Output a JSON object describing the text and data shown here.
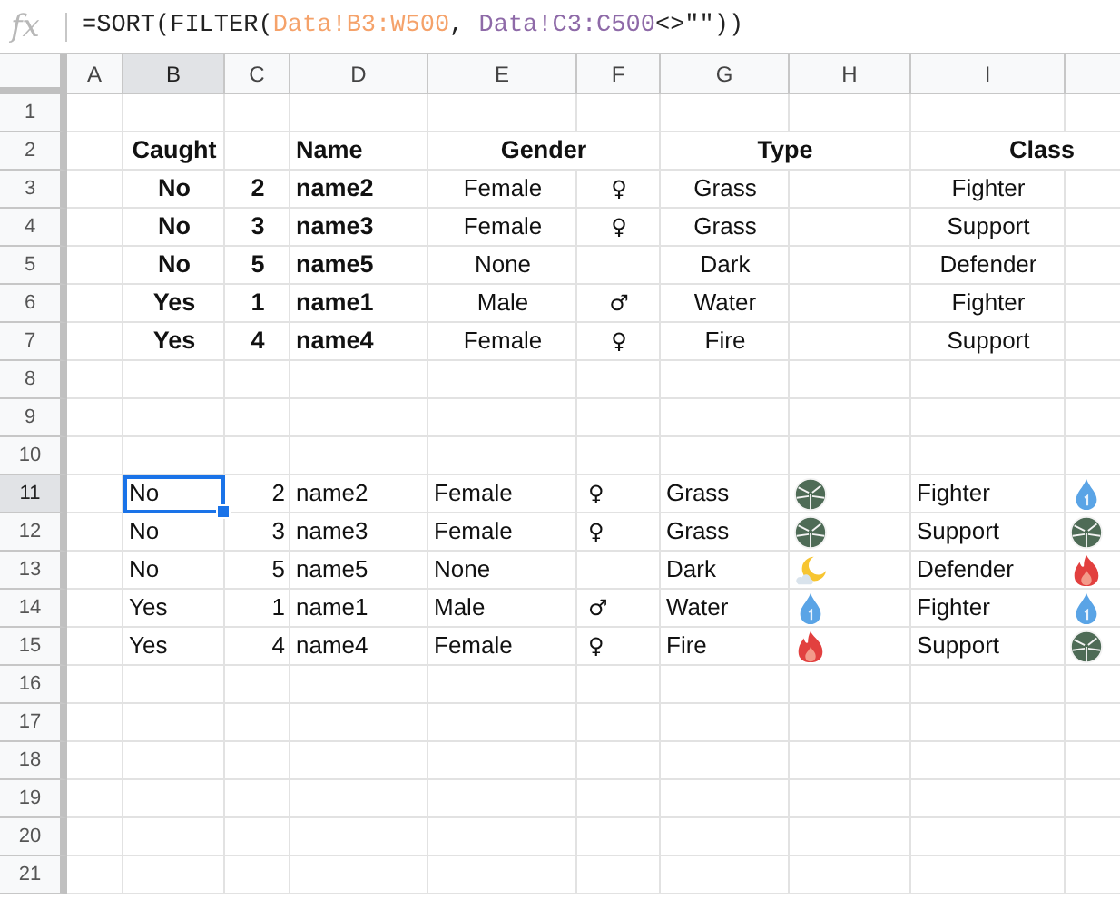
{
  "formula_bar": {
    "fx": "fx",
    "segments": [
      {
        "text": "=SORT(FILTER(",
        "color": "#222222"
      },
      {
        "text": "Data!B3:W500",
        "color": "#f5a26a"
      },
      {
        "text": ", ",
        "color": "#222222"
      },
      {
        "text": "Data!C3:C500",
        "color": "#8e6aa8"
      },
      {
        "text": "<>\"\"))",
        "color": "#222222"
      }
    ]
  },
  "columns": [
    {
      "label": "A",
      "selected": false
    },
    {
      "label": "B",
      "selected": true
    },
    {
      "label": "C",
      "selected": false
    },
    {
      "label": "D",
      "selected": false
    },
    {
      "label": "E",
      "selected": false
    },
    {
      "label": "F",
      "selected": false
    },
    {
      "label": "G",
      "selected": false
    },
    {
      "label": "H",
      "selected": false
    },
    {
      "label": "I",
      "selected": false
    },
    {
      "selected": false
    }
  ],
  "rows": [
    {
      "label": "1",
      "selected": false
    },
    {
      "label": "2",
      "selected": false
    },
    {
      "label": "3",
      "selected": false
    },
    {
      "label": "4",
      "selected": false
    },
    {
      "label": "5",
      "selected": false
    },
    {
      "label": "6",
      "selected": false
    },
    {
      "label": "7",
      "selected": false
    },
    {
      "label": "8",
      "selected": false
    },
    {
      "label": "9",
      "selected": false
    },
    {
      "label": "10",
      "selected": false
    },
    {
      "label": "11",
      "selected": true
    },
    {
      "label": "12",
      "selected": false
    },
    {
      "label": "13",
      "selected": false
    },
    {
      "label": "14",
      "selected": false
    },
    {
      "label": "15",
      "selected": false
    },
    {
      "label": "16",
      "selected": false
    },
    {
      "label": "17",
      "selected": false
    },
    {
      "label": "18",
      "selected": false
    },
    {
      "label": "19",
      "selected": false
    },
    {
      "label": "20",
      "selected": false
    },
    {
      "label": "21",
      "selected": false
    }
  ],
  "header_table": {
    "headers": {
      "caught": "Caught",
      "name": "Name",
      "gender": "Gender",
      "type": "Type",
      "class": "Class"
    },
    "rows": [
      {
        "caught": "No",
        "number": "2",
        "name": "name2",
        "gender": "Female",
        "symbol": "♀",
        "type": "Grass",
        "class": "Fighter"
      },
      {
        "caught": "No",
        "number": "3",
        "name": "name3",
        "gender": "Female",
        "symbol": "♀",
        "type": "Grass",
        "class": "Support"
      },
      {
        "caught": "No",
        "number": "5",
        "name": "name5",
        "gender": "None",
        "type": "Dark",
        "class": "Defender"
      },
      {
        "caught": "Yes",
        "number": "1",
        "name": "name1",
        "gender": "Male",
        "symbol": "♂",
        "type": "Water",
        "class": "Fighter"
      },
      {
        "caught": "Yes",
        "number": "4",
        "name": "name4",
        "gender": "Female",
        "symbol": "♀",
        "type": "Fire",
        "class": "Support"
      }
    ]
  },
  "filter_table": {
    "rows": [
      {
        "caught": "No",
        "selected": true,
        "number": "2",
        "name": "name2",
        "gender": "Female",
        "symbol": "♀",
        "type": "Grass",
        "type_icon": {
          "kind": "leaf"
        },
        "class": "Fighter",
        "class_icon": {
          "kind": "drop"
        }
      },
      {
        "caught": "No",
        "selected": false,
        "number": "3",
        "name": "name3",
        "gender": "Female",
        "symbol": "♀",
        "type": "Grass",
        "type_icon": {
          "kind": "leaf"
        },
        "class": "Support",
        "class_icon": {
          "kind": "leaf"
        }
      },
      {
        "caught": "No",
        "selected": false,
        "number": "5",
        "name": "name5",
        "gender": "None",
        "type": "Dark",
        "type_icon": {
          "kind": "moon"
        },
        "class": "Defender",
        "class_icon": {
          "kind": "fire"
        }
      },
      {
        "caught": "Yes",
        "selected": false,
        "number": "1",
        "name": "name1",
        "gender": "Male",
        "symbol": "♂",
        "type": "Water",
        "type_icon": {
          "kind": "drop"
        },
        "class": "Fighter",
        "class_icon": {
          "kind": "drop"
        }
      },
      {
        "caught": "Yes",
        "selected": false,
        "number": "4",
        "name": "name4",
        "gender": "Female",
        "symbol": "♀",
        "type": "Fire",
        "type_icon": {
          "kind": "fire"
        },
        "class": "Support",
        "class_icon": {
          "kind": "leaf"
        }
      }
    ]
  }
}
